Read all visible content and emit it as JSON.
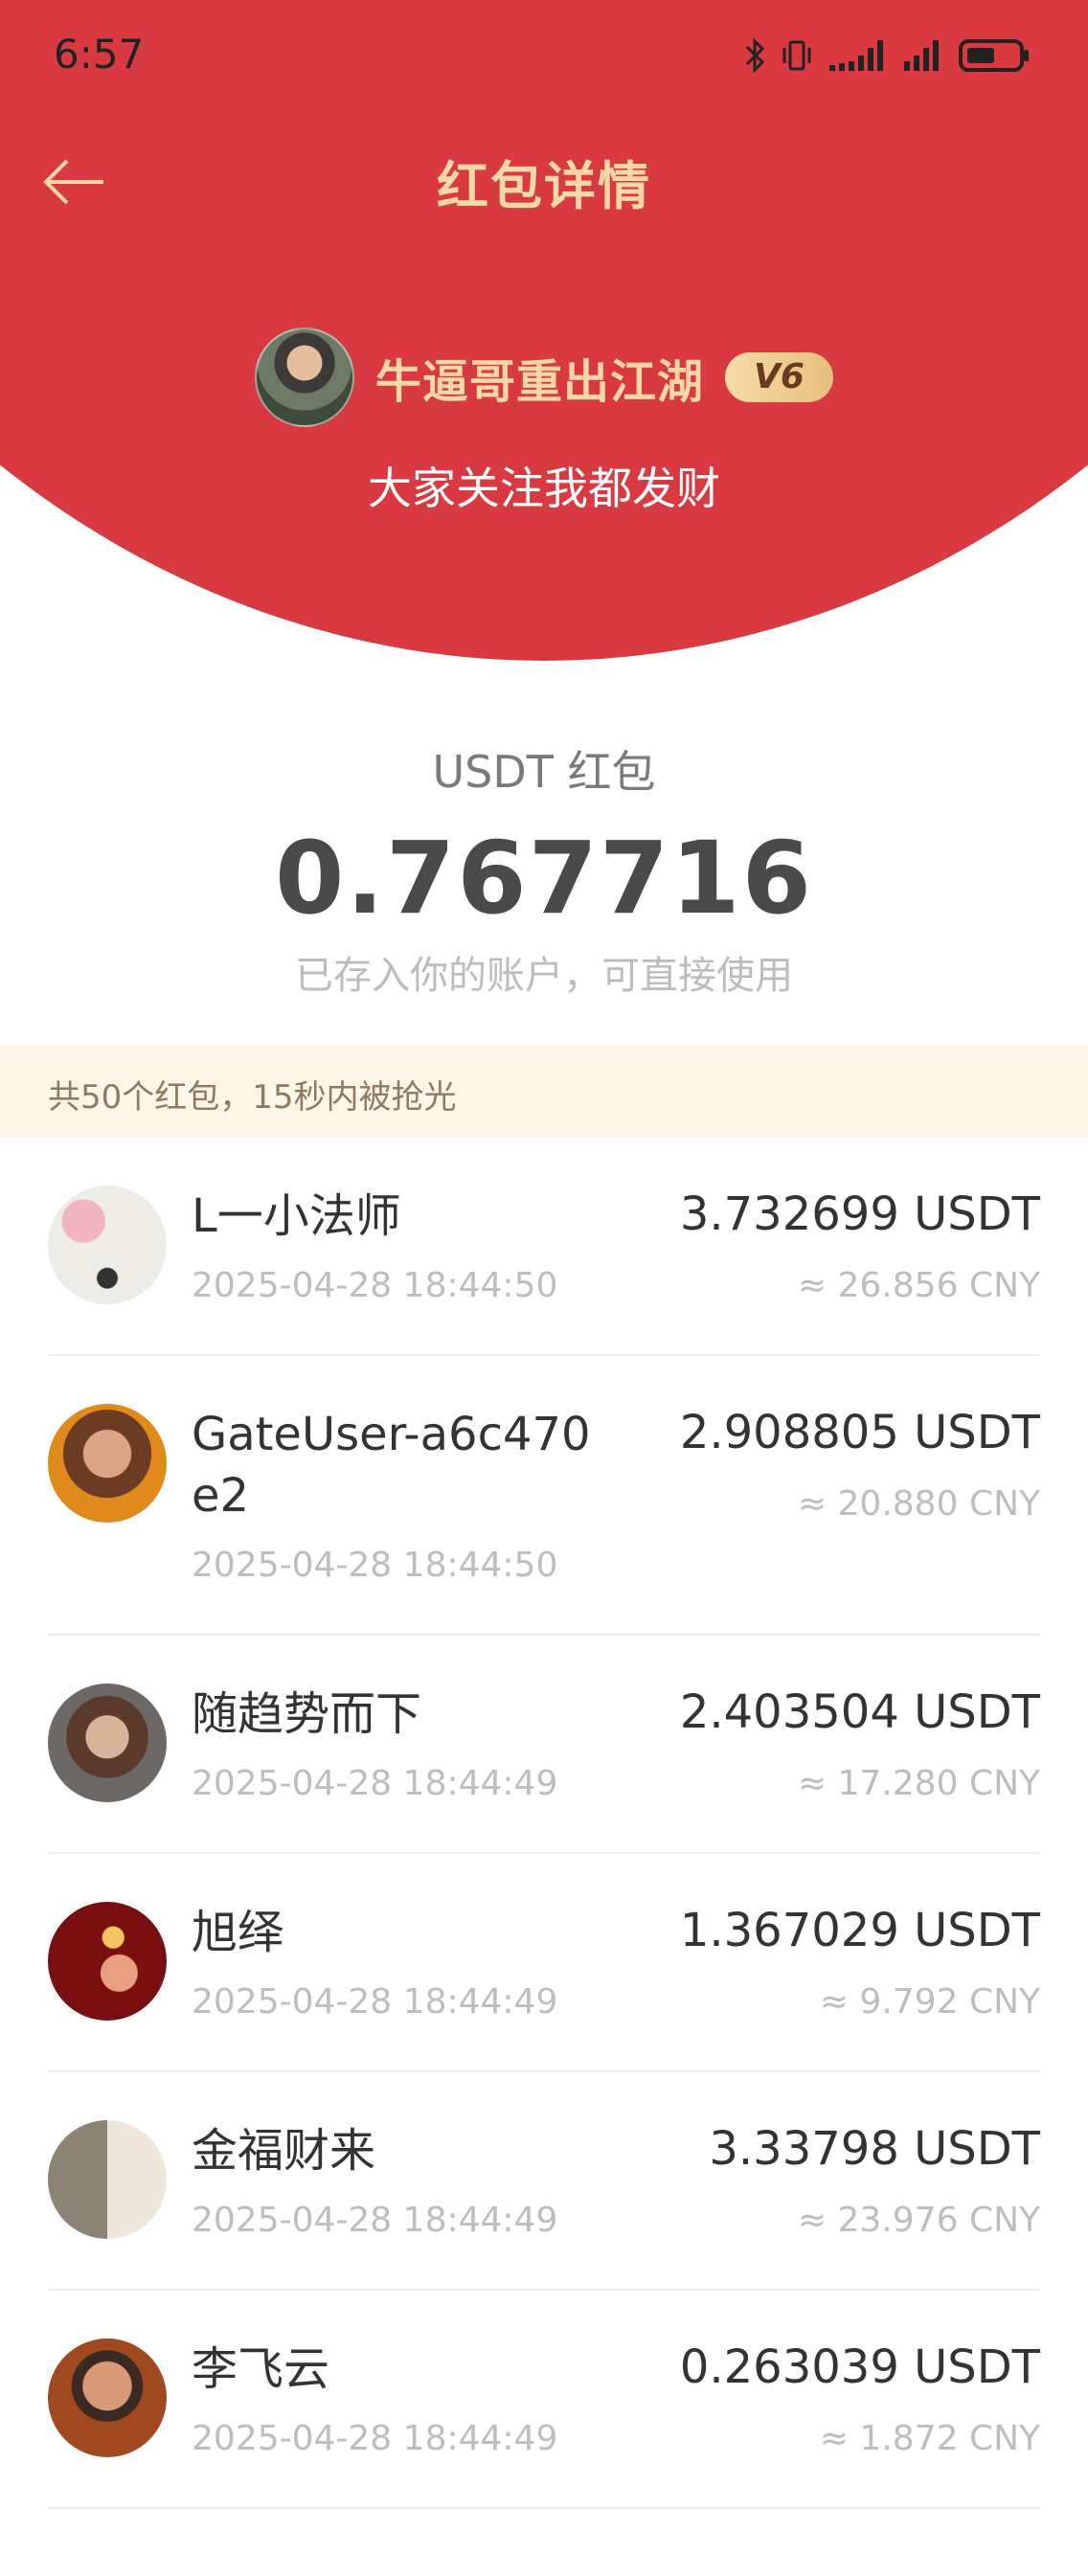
{
  "status_bar": {
    "time": "6:57"
  },
  "header": {
    "title": "红包详情",
    "sender_name": "牛逼哥重出江湖",
    "vip_level": "V6",
    "greeting": "大家关注我都发财"
  },
  "packet": {
    "currency_label": "USDT 红包",
    "amount": "0.767716",
    "note": "已存入你的账户，可直接使用"
  },
  "summary": "共50个红包，15秒内被抢光",
  "claims": [
    {
      "name": "L一小法师",
      "time": "2025-04-28 18:44:50",
      "usdt": "3.732699 USDT",
      "cny": "≈ 26.856 CNY"
    },
    {
      "name": "GateUser-a6c470e2",
      "time": "2025-04-28 18:44:50",
      "usdt": "2.908805 USDT",
      "cny": "≈ 20.880 CNY"
    },
    {
      "name": "随趋势而下",
      "time": "2025-04-28 18:44:49",
      "usdt": "2.403504 USDT",
      "cny": "≈ 17.280 CNY"
    },
    {
      "name": "旭绎",
      "time": "2025-04-28 18:44:49",
      "usdt": "1.367029 USDT",
      "cny": "≈ 9.792 CNY"
    },
    {
      "name": "金福财来",
      "time": "2025-04-28 18:44:49",
      "usdt": "3.33798 USDT",
      "cny": "≈ 23.976 CNY"
    },
    {
      "name": "李飞云",
      "time": "2025-04-28 18:44:49",
      "usdt": "0.263039 USDT",
      "cny": "≈ 1.872 CNY"
    }
  ]
}
